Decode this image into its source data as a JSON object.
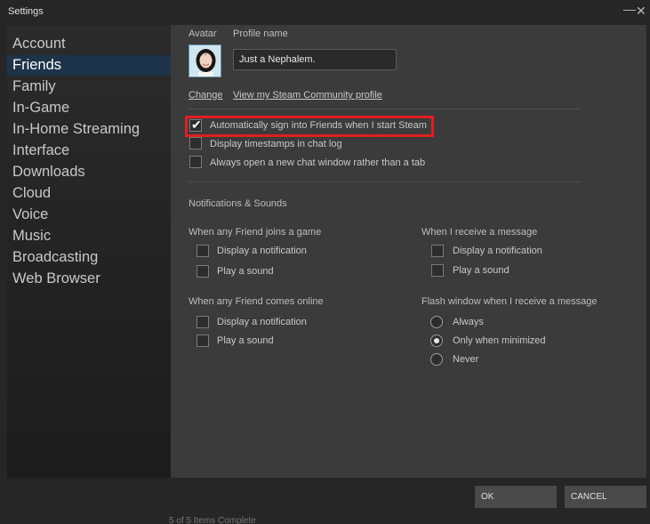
{
  "window": {
    "title": "Settings"
  },
  "sidebar": {
    "items": [
      {
        "label": "Account"
      },
      {
        "label": "Friends"
      },
      {
        "label": "Family"
      },
      {
        "label": "In-Game"
      },
      {
        "label": "In-Home Streaming"
      },
      {
        "label": "Interface"
      },
      {
        "label": "Downloads"
      },
      {
        "label": "Cloud"
      },
      {
        "label": "Voice"
      },
      {
        "label": "Music"
      },
      {
        "label": "Broadcasting"
      },
      {
        "label": "Web Browser"
      }
    ],
    "active": "Friends"
  },
  "profile": {
    "avatar_label": "Avatar",
    "name_label": "Profile name",
    "name_value": "Just a Nephalem.",
    "change_link": "Change",
    "community_link": "View my Steam Community profile"
  },
  "options": {
    "auto_sign_in": {
      "label": "Automatically sign into Friends when I start Steam",
      "checked": true
    },
    "timestamps": {
      "label": "Display timestamps in chat log",
      "checked": false
    },
    "new_window": {
      "label": "Always open a new chat window rather than a tab",
      "checked": false
    }
  },
  "notifications": {
    "section_title": "Notifications & Sounds",
    "joins_game": {
      "title": "When any Friend joins a game",
      "display": "Display a notification",
      "sound": "Play a sound"
    },
    "receive_message": {
      "title": "When I receive a message",
      "display": "Display a notification",
      "sound": "Play a sound"
    },
    "comes_online": {
      "title": "When any Friend comes online",
      "display": "Display a notification",
      "sound": "Play a sound"
    },
    "flash_window": {
      "title": "Flash window when I receive a message",
      "options": [
        "Always",
        "Only when minimized",
        "Never"
      ],
      "selected": "Only when minimized"
    }
  },
  "footer": {
    "ok": "OK",
    "cancel": "CANCEL",
    "status": "5 of 5 Items Complete"
  },
  "colors": {
    "highlight": "#e01d22",
    "active_item": "#1d3349"
  }
}
